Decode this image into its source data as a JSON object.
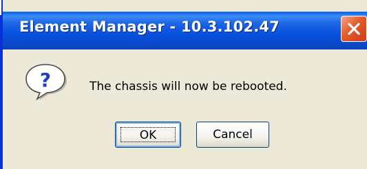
{
  "window": {
    "title": "Element Manager - 10.3.102.47",
    "close_icon": "close-icon"
  },
  "dialog": {
    "icon": "question-icon",
    "message": "The chassis will now be rebooted."
  },
  "buttons": {
    "ok_label": "OK",
    "cancel_label": "Cancel"
  },
  "colors": {
    "titlebar": "#0a55de",
    "dialog_background": "#ece9d8",
    "close_button": "#e35a2a"
  }
}
